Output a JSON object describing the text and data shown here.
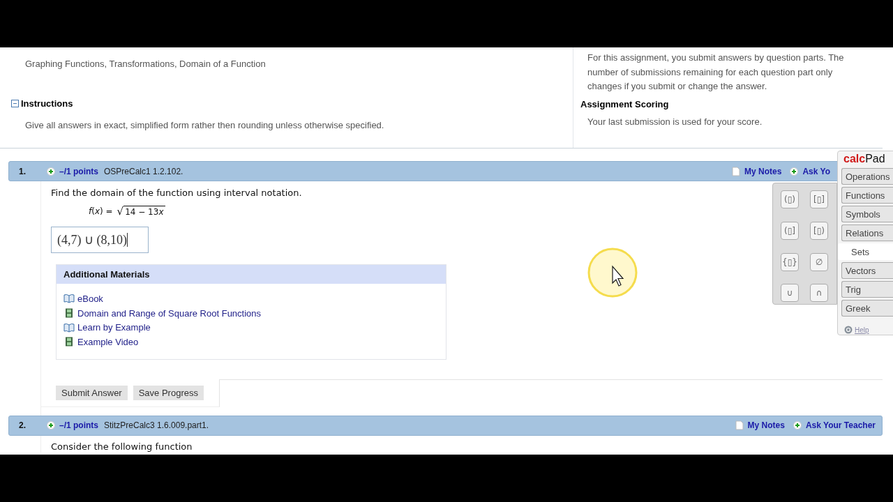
{
  "topic": "Graphing Functions, Transformations, Domain of a Function",
  "instructions": {
    "title": "Instructions",
    "expanded": true,
    "text": "Give all answers in exact, simplified form rather then rounding unless otherwise specified."
  },
  "info": {
    "text": "For this assignment, you submit answers by question parts. The number of submissions remaining for each question part only changes if you submit or change the answer.",
    "scoring_title": "Assignment Scoring",
    "scoring_text": "Your last submission is used for your score."
  },
  "questions": [
    {
      "number": "1.",
      "points": "–/1 points",
      "source": "OSPreCalc1 1.2.102.",
      "links": [
        {
          "kind": "notes",
          "label": "My Notes"
        },
        {
          "kind": "ask",
          "label": "Ask Yo"
        }
      ],
      "prompt": "Find the domain of the function using interval notation.",
      "function_lhs": "*f*(*x*) =",
      "radical": "√",
      "radicand": "14 − 13",
      "radicand_var": "x",
      "answer": "(4,7) ∪ (8,10)",
      "materials": {
        "title": "Additional Materials",
        "items": [
          {
            "kind": "book",
            "label": "eBook"
          },
          {
            "kind": "video",
            "label": "Domain and Range of Square Root Functions"
          },
          {
            "kind": "book",
            "label": "Learn by Example"
          },
          {
            "kind": "video",
            "label": "Example Video"
          }
        ]
      },
      "buttons": [
        "Submit Answer",
        "Save Progress"
      ]
    },
    {
      "number": "2.",
      "points": "–/1 points",
      "source": "StitzPreCalc3 1.6.009.part1.",
      "links": [
        {
          "kind": "notes",
          "label": "My Notes"
        },
        {
          "kind": "ask",
          "label": "Ask Your Teacher"
        }
      ],
      "prompt": "Consider the following function"
    }
  ],
  "calcpad": {
    "logo_bold": "calc",
    "logo_rest": "Pad",
    "tabs": [
      {
        "label": "Operations",
        "selected": false
      },
      {
        "label": "Functions",
        "selected": false
      },
      {
        "label": "Symbols",
        "selected": false
      },
      {
        "label": "Relations",
        "selected": false
      },
      {
        "label": "Sets",
        "selected": true
      },
      {
        "label": "Vectors",
        "selected": false
      },
      {
        "label": "Trig",
        "selected": false
      },
      {
        "label": "Greek",
        "selected": false
      }
    ],
    "palette": [
      "(▯)",
      "[▯]",
      "(▯]",
      "[▯)",
      "{▯}",
      "∅",
      "∪",
      "∩"
    ],
    "help": "Help"
  }
}
